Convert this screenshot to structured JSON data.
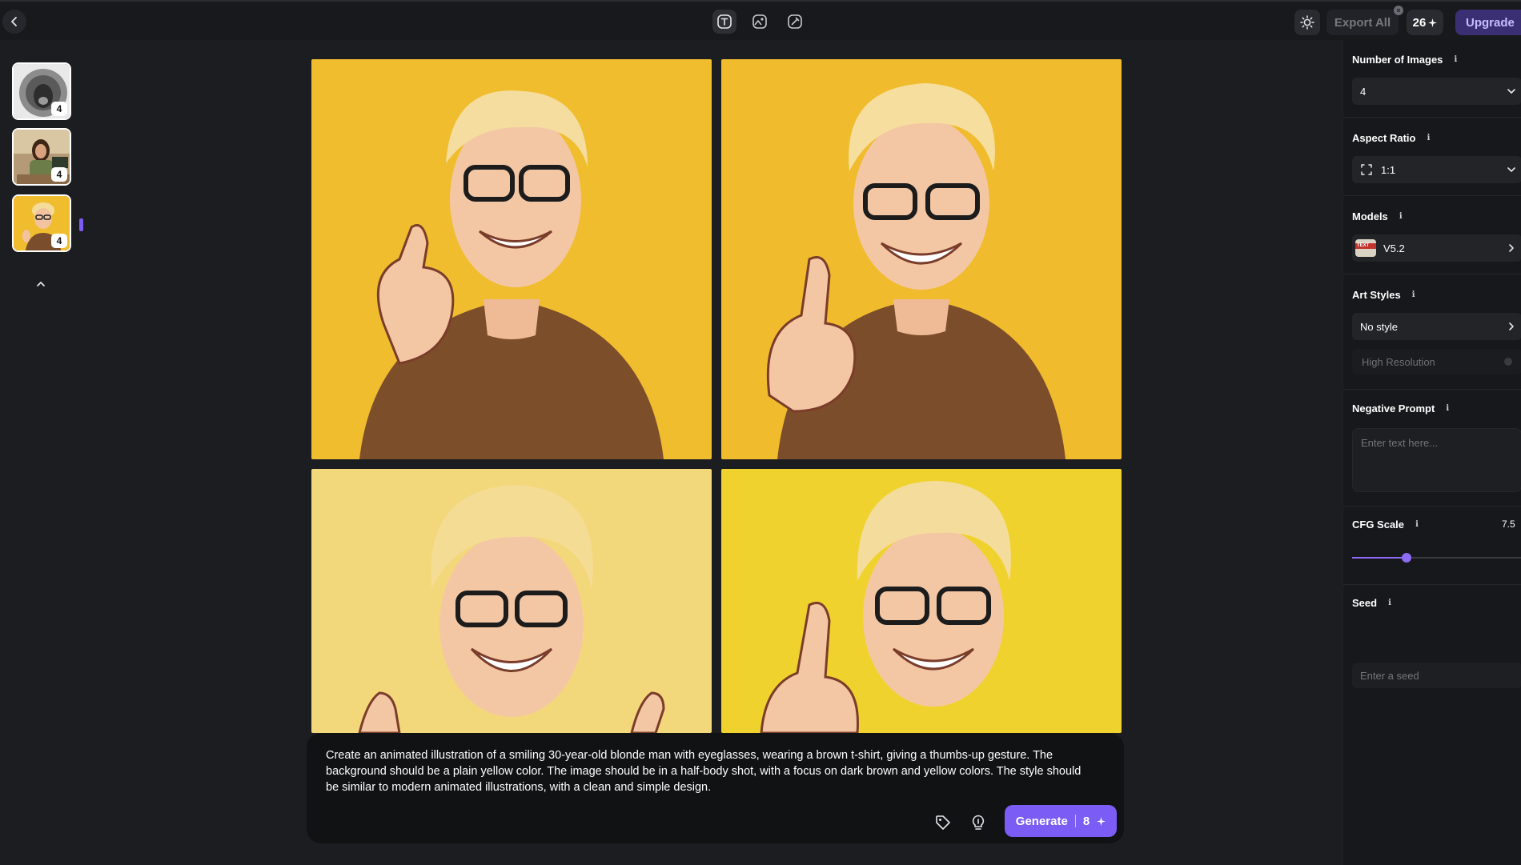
{
  "topbar": {
    "export_label": "Export All",
    "credits_value": "26",
    "credits_icon": "sparkle-icon",
    "upgrade_label": "Upgrade",
    "modes": [
      "text-to-image-icon",
      "image-to-image-icon",
      "sketch-icon"
    ],
    "active_mode": "text-to-image-icon"
  },
  "history": {
    "items": [
      {
        "name": "lion-sketch",
        "count": "4"
      },
      {
        "name": "woman-at-desk",
        "count": "4"
      },
      {
        "name": "blonde-man-thumbs-up",
        "count": "4"
      }
    ],
    "selected_index": 2
  },
  "prompt": {
    "text": "Create an animated illustration of a smiling 30-year-old blonde man with eyeglasses, wearing a brown t-shirt, giving a thumbs-up gesture. The background should be a plain yellow color. The image should be in a half-body shot, with a focus on dark brown and yellow colors. The style should be similar to modern animated illustrations, with a clean and simple design.",
    "generate_label": "Generate",
    "generate_cost": "8"
  },
  "settings": {
    "num_images_label": "Number of Images",
    "num_images_value": "4",
    "aspect_label": "Aspect Ratio",
    "aspect_value": "1:1",
    "models_label": "Models",
    "model_value": "V5.2",
    "model_thumb_text": "TEXT",
    "art_styles_label": "Art Styles",
    "art_style_value": "No style",
    "high_res_label": "High Resolution",
    "negative_label": "Negative Prompt",
    "negative_placeholder": "Enter text here...",
    "cfg_label": "CFG Scale",
    "cfg_value": "7.5",
    "cfg_fraction": 0.32,
    "seed_label": "Seed",
    "seed_placeholder": "Enter a seed"
  },
  "colors": {
    "accent": "#7b5cf5",
    "upgrade_bg": "#3b2f73",
    "panel_bg": "#17181b",
    "canvas_bg": "#1c1d21"
  }
}
